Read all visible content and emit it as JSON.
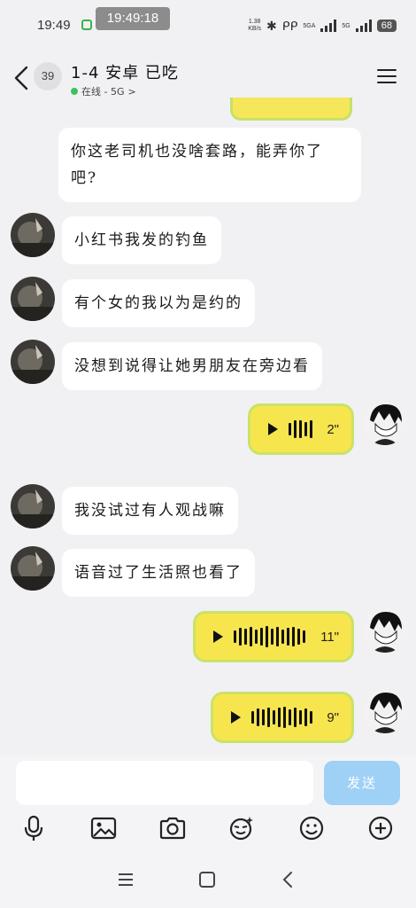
{
  "status_bar": {
    "time": "19:49",
    "overlay_time": "19:49:18",
    "more": "...",
    "net_speed_value": "1.38",
    "net_speed_unit": "KB/s",
    "network_label": "5GA",
    "network_label2": "5G",
    "battery": "68"
  },
  "header": {
    "unread_count": "39",
    "title": "1-4 安卓 已吃",
    "status": "在线 - 5G",
    "status_arrow": ">"
  },
  "messages": [
    {
      "side": "left",
      "type": "text",
      "text": "你这老司机也没啥套路，能弄你了吧?"
    },
    {
      "side": "left",
      "type": "text",
      "text": "小红书我发的钓鱼"
    },
    {
      "side": "left",
      "type": "text",
      "text": "有个女的我以为是约的"
    },
    {
      "side": "left",
      "type": "text",
      "text": "没想到说得让她男朋友在旁边看"
    },
    {
      "side": "right",
      "type": "voice",
      "duration": "2\""
    },
    {
      "side": "left",
      "type": "text",
      "text": "我没试过有人观战嘛"
    },
    {
      "side": "left",
      "type": "text",
      "text": "语音过了生活照也看了"
    },
    {
      "side": "right",
      "type": "voice",
      "duration": "11\""
    },
    {
      "side": "right",
      "type": "voice",
      "duration": "9\""
    }
  ],
  "input": {
    "placeholder": "",
    "send_label": "发送"
  },
  "toolbar": [
    "mic-icon",
    "image-icon",
    "camera-icon",
    "emoji-sticker-icon",
    "smiley-icon",
    "plus-icon"
  ],
  "colors": {
    "voice_bubble": "#f7e54e",
    "voice_border": "#c9e26a",
    "send_button": "#9fd0f5",
    "online": "#3ec15c",
    "background": "#f1f1f4"
  }
}
